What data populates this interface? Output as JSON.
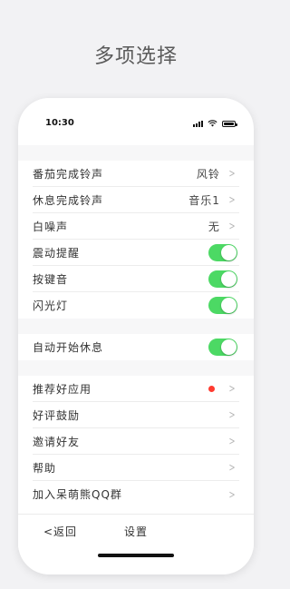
{
  "hero": {
    "title": "多项选择"
  },
  "status_bar": {
    "time": "10:30"
  },
  "groups": [
    {
      "rows": [
        {
          "label": "番茄完成铃声",
          "value": "风铃",
          "control": "chevron"
        },
        {
          "label": "休息完成铃声",
          "value": "音乐1",
          "control": "chevron"
        },
        {
          "label": "白噪声",
          "value": "无",
          "control": "chevron"
        },
        {
          "label": "震动提醒",
          "control": "toggle",
          "on": true
        },
        {
          "label": "按键音",
          "control": "toggle",
          "on": true
        },
        {
          "label": "闪光灯",
          "control": "toggle",
          "on": true
        }
      ]
    },
    {
      "rows": [
        {
          "label": "自动开始休息",
          "control": "toggle",
          "on": true
        }
      ]
    },
    {
      "rows": [
        {
          "label": "推荐好应用",
          "control": "chevron",
          "badge": "red-dot"
        },
        {
          "label": "好评鼓励",
          "control": "chevron"
        },
        {
          "label": "邀请好友",
          "control": "chevron"
        },
        {
          "label": "帮助",
          "control": "chevron"
        },
        {
          "label": "加入呆萌熊QQ群",
          "control": "chevron"
        }
      ]
    }
  ],
  "bottom_bar": {
    "back_label": "<返回",
    "title": "设置"
  },
  "colors": {
    "toggle_on": "#4cd964",
    "badge": "#ff3b30"
  }
}
